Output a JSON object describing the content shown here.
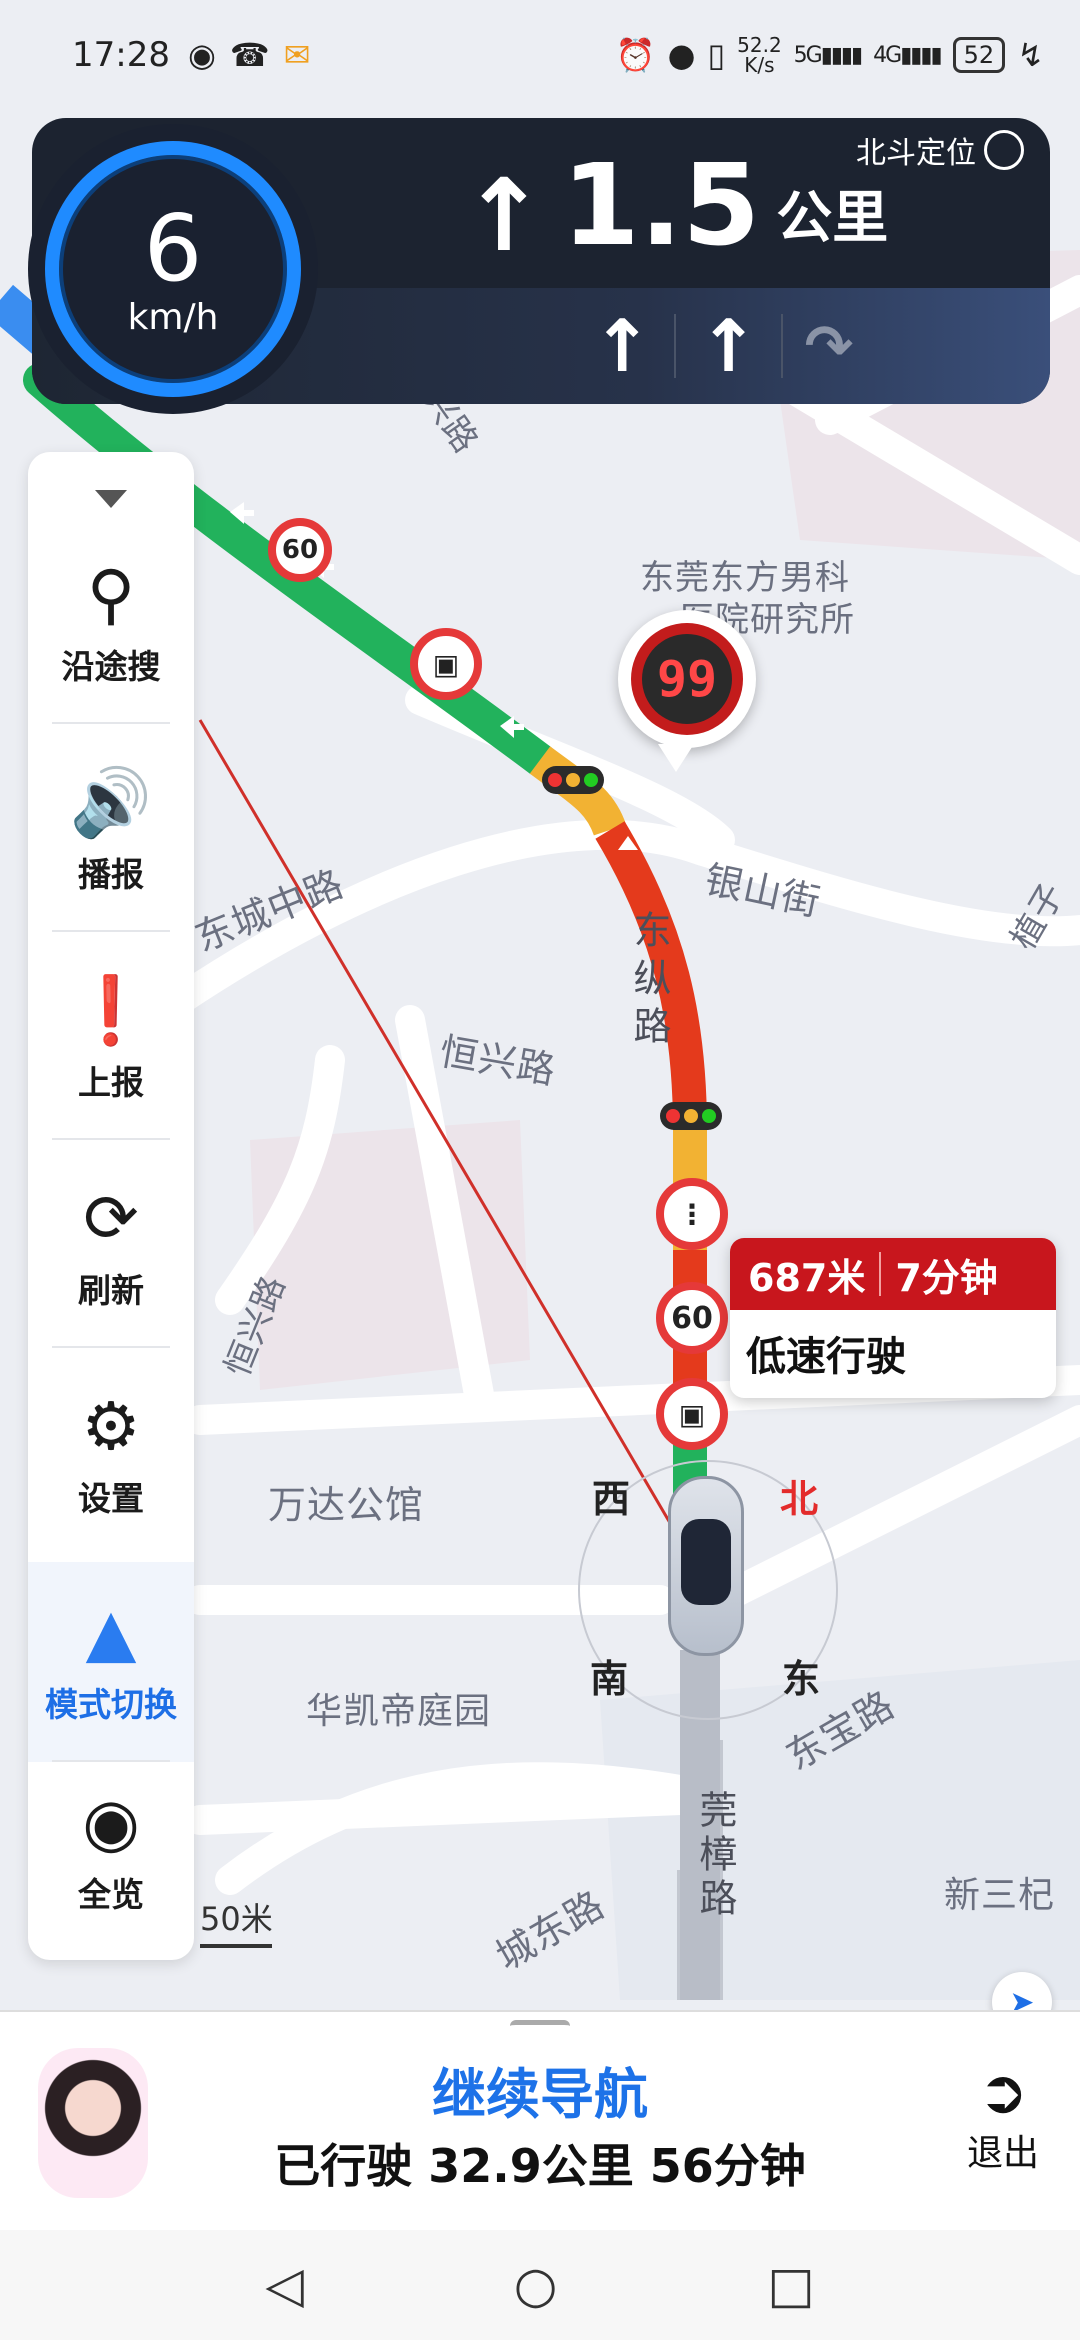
{
  "status_bar": {
    "time": "17:28",
    "net_speed_value": "52.2",
    "net_speed_unit": "K/s",
    "sig1": "5G",
    "sig2": "4G",
    "battery": "52"
  },
  "nav_banner": {
    "positioning": "北斗定位",
    "distance": "1.5",
    "distance_unit": "公里"
  },
  "speedometer": {
    "value": "6",
    "unit": "km/h"
  },
  "toolbar": {
    "items": [
      {
        "label": "沿途搜",
        "icon": "search-icon"
      },
      {
        "label": "播报",
        "icon": "speaker-icon"
      },
      {
        "label": "上报",
        "icon": "report-icon"
      },
      {
        "label": "刷新",
        "icon": "refresh-icon"
      },
      {
        "label": "设置",
        "icon": "gear-icon"
      },
      {
        "label": "模式切换",
        "icon": "mode-switch-icon"
      },
      {
        "label": "全览",
        "icon": "overview-icon"
      }
    ]
  },
  "map_labels": {
    "road1": "东城中路",
    "road2": "东纵路",
    "road3": "银山街",
    "road4": "恒兴路",
    "road5": "新兴路",
    "road6": "莞樟路",
    "road7": "东宝路",
    "road8": "城东路",
    "road9": "恒兴路",
    "poi1a": "东莞东方男科",
    "poi1b": "医院研究所",
    "poi2": "万达公馆",
    "poi3": "华凯帝庭园",
    "poi4": "新三杞",
    "poi5": "植子"
  },
  "speed_camera_limit": "99",
  "speed_signs": [
    "60",
    "60"
  ],
  "traffic_info": {
    "distance": "687米",
    "time": "7分钟",
    "status": "低速行驶"
  },
  "compass": {
    "n": "北",
    "s": "南",
    "e": "东",
    "w": "西"
  },
  "scale": "50米",
  "bottom_panel": {
    "continue": "继续导航",
    "driven": "已行驶 32.9公里 56分钟",
    "exit": "退出"
  },
  "colors": {
    "accent": "#1e6fe6",
    "route_green": "#22b25c",
    "route_red": "#e43a1c",
    "route_yellow": "#f2b233"
  }
}
